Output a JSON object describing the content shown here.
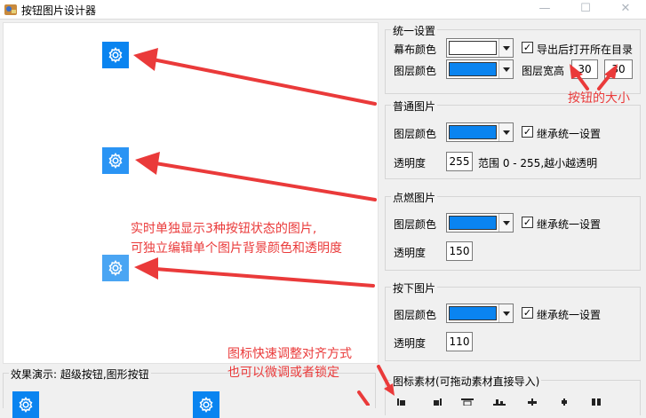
{
  "window": {
    "title": "按钮图片设计器",
    "minimize_glyph": "—",
    "maximize_glyph": "☐",
    "close_glyph": "✕"
  },
  "colors": {
    "canvas": "#ffffff",
    "layer": "#0a84f0",
    "annotation": "#ea3a3a"
  },
  "icons": {
    "preview": "gear-icon"
  },
  "unified": {
    "legend": "统一设置",
    "canvas_color_label": "幕布颜色",
    "layer_color_label": "图层颜色",
    "export_open_label": "导出后打开所在目录",
    "size_label": "图层宽高",
    "width": "30",
    "height": "30"
  },
  "normal": {
    "legend": "普通图片",
    "layer_color_label": "图层颜色",
    "inherit_label": "继承统一设置",
    "opacity_label": "透明度",
    "opacity": "255",
    "range_hint": "范围 0 - 255,越小越透明"
  },
  "hover": {
    "legend": "点燃图片",
    "layer_color_label": "图层颜色",
    "inherit_label": "继承统一设置",
    "opacity_label": "透明度",
    "opacity": "150"
  },
  "pressed": {
    "legend": "按下图片",
    "layer_color_label": "图层颜色",
    "inherit_label": "继承统一设置",
    "opacity_label": "透明度",
    "opacity": "110"
  },
  "material": {
    "legend": "图标素材(可拖动素材直接导入)"
  },
  "demo": {
    "legend": "效果演示: 超级按钮,图形按钮"
  },
  "annotations": {
    "button_size": "按钮的大小",
    "states_line1": "实时单独显示3种按钮状态的图片,",
    "states_line2": "可独立编辑单个图片背景颜色和透明度",
    "align_line1": "图标快速调整对齐方式",
    "align_line2": "也可以微调或者锁定"
  }
}
